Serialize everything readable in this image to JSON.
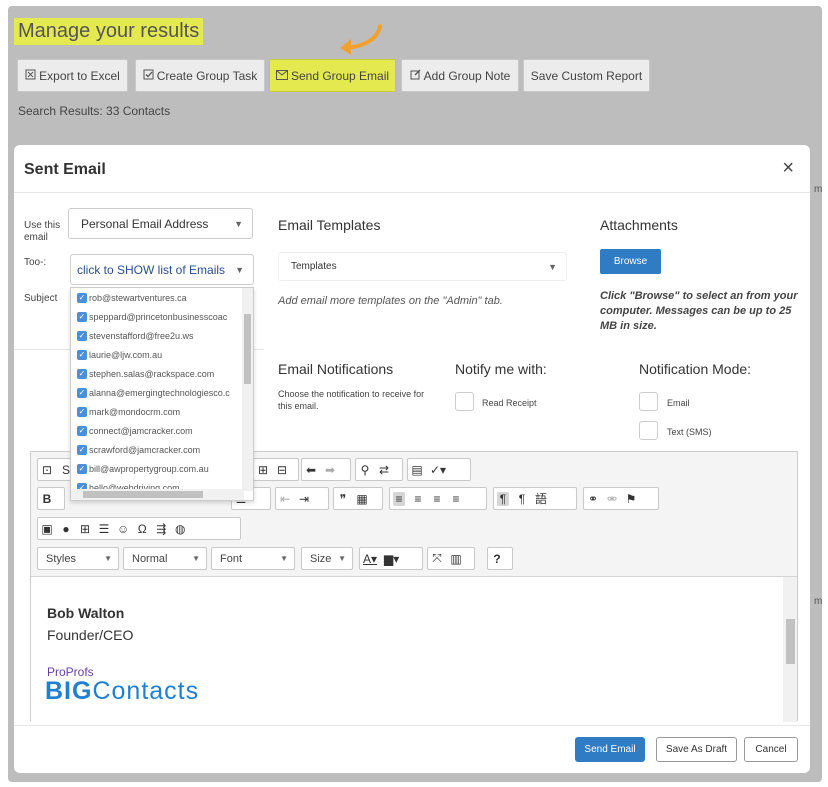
{
  "page": {
    "title": "Manage your results",
    "toolbar": [
      {
        "label": "Export to Excel",
        "icon": "excel-icon"
      },
      {
        "label": "Create Group Task",
        "icon": "checkmark-icon"
      },
      {
        "label": "Send Group Email",
        "icon": "envelope-icon"
      },
      {
        "label": "Add Group Note",
        "icon": "edit-icon"
      },
      {
        "label": "Save Custom Report"
      }
    ],
    "results": "Search Results: 33 Contacts",
    "highlight_color": "#e3e94f",
    "arrow_color": "#f2a12e",
    "right_fragment": "m"
  },
  "modal": {
    "title": "Sent Email",
    "close": "×",
    "use_label": "Use this email",
    "use_value": "Personal Email Address",
    "to_label": "Too-:",
    "to_value": "click to SHOW list of Emails",
    "subject_label": "Subject",
    "emails": [
      "rob@stewartventures.ca",
      "speppard@princetonbusinesscoac",
      "stevenstafford@free2u.ws",
      "laurie@ljw.com.au",
      "stephen.salas@rackspace.com",
      "alanna@emergingtechnologiesco.c",
      "mark@mondocrm.com",
      "connect@jamcracker.com",
      "scrawford@jamcracker.com",
      "bill@awpropertygroup.com.au",
      "hello@webdriving.com"
    ],
    "templates": {
      "heading": "Email Templates",
      "select": "Templates",
      "hint": "Add email more templates on the \"Admin\" tab."
    },
    "attachments": {
      "heading": "Attachments",
      "browse": "Browse",
      "hint": "Click \"Browse\" to select an from your computer. Messages can be up to 25 MB in size."
    },
    "notifications": {
      "heading": "Email Notifications",
      "desc": "Choose the notification to receive for this email.",
      "notify_heading": "Notify me with:",
      "read_receipt": "Read Receipt",
      "mode_heading": "Notification Mode:",
      "mode_email": "Email",
      "mode_sms": "Text (SMS)"
    },
    "editor": {
      "source_label": "S",
      "styles": "Styles",
      "format": "Normal",
      "font": "Font",
      "size": "Size",
      "help": "?",
      "signature_name": "Bob Walton",
      "signature_role": "Founder/CEO",
      "logo_prefix": "ProProfs",
      "logo_bold": "BIG",
      "logo_rest": "Contacts"
    },
    "buttons": {
      "send": "Send Email",
      "draft": "Save As Draft",
      "cancel": "Cancel"
    },
    "accent_color": "#2f7bc4",
    "checkbox_color": "#4a8fdc"
  }
}
